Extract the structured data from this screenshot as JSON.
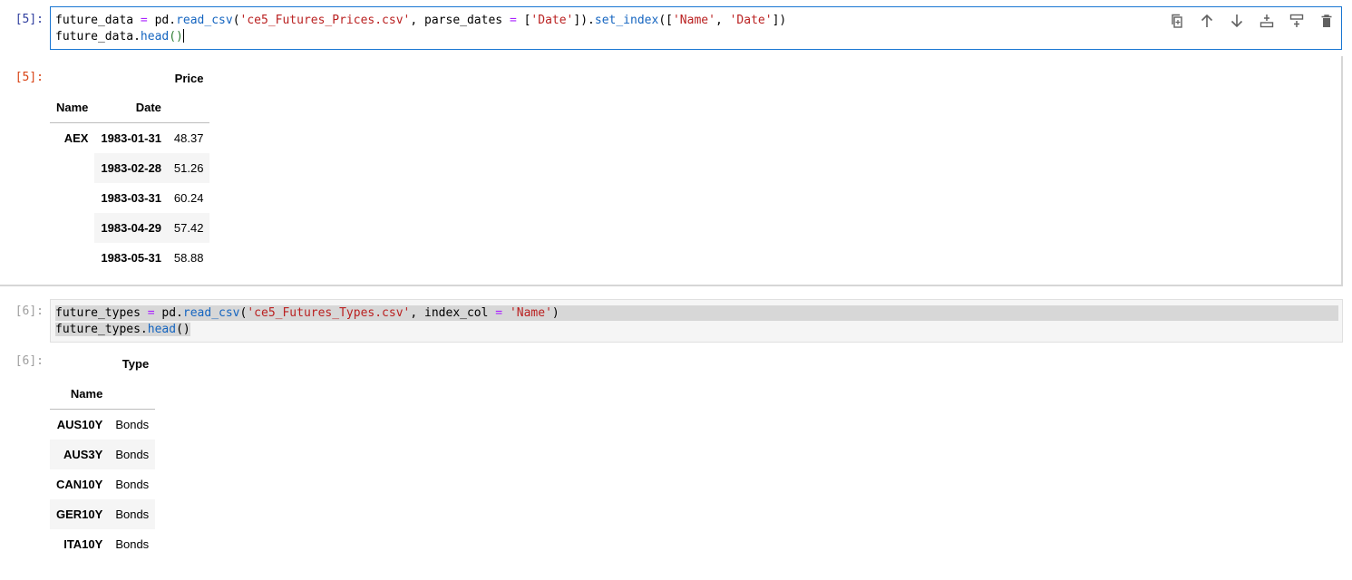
{
  "cells": [
    {
      "input_prompt": "[5]:",
      "output_prompt": "[5]:",
      "code_line1": {
        "t1": "future_data ",
        "op1": "=",
        "t2": " pd.",
        "fn1": "read_csv",
        "t3": "(",
        "s1": "'ce5_Futures_Prices.csv'",
        "t4": ", parse_dates ",
        "op2": "=",
        "t5": " [",
        "s2": "'Date'",
        "t6": "]).",
        "fn2": "set_index",
        "t7": "([",
        "s3": "'Name'",
        "t8": ", ",
        "s4": "'Date'",
        "t9": "])"
      },
      "code_line2": {
        "t1": "future_data.",
        "fn1": "head",
        "paren": "()"
      },
      "output_table": {
        "column": "Price",
        "index_names": [
          "Name",
          "Date"
        ],
        "first_level": "AEX",
        "rows": [
          {
            "date": "1983-01-31",
            "price": "48.37"
          },
          {
            "date": "1983-02-28",
            "price": "51.26"
          },
          {
            "date": "1983-03-31",
            "price": "60.24"
          },
          {
            "date": "1983-04-29",
            "price": "57.42"
          },
          {
            "date": "1983-05-31",
            "price": "58.88"
          }
        ]
      }
    },
    {
      "input_prompt": "[6]:",
      "output_prompt": "[6]:",
      "code_line1": {
        "t1": "future_types ",
        "op1": "=",
        "t2": " pd.",
        "fn1": "read_csv",
        "t3": "(",
        "s1": "'ce5_Futures_Types.csv'",
        "t4": ", index_col ",
        "op2": "=",
        "t5": " ",
        "s2": "'Name'",
        "t6": ")"
      },
      "code_line2": {
        "t1": "future_types.",
        "fn1": "head",
        "paren": "()"
      },
      "output_table": {
        "column": "Type",
        "index_name": "Name",
        "rows": [
          {
            "name": "AUS10Y",
            "type": "Bonds"
          },
          {
            "name": "AUS3Y",
            "type": "Bonds"
          },
          {
            "name": "CAN10Y",
            "type": "Bonds"
          },
          {
            "name": "GER10Y",
            "type": "Bonds"
          },
          {
            "name": "ITA10Y",
            "type": "Bonds"
          }
        ]
      }
    }
  ],
  "toolbar": {
    "icons": [
      "duplicate-icon",
      "move-up-icon",
      "move-down-icon",
      "insert-above-icon",
      "insert-below-icon",
      "delete-icon"
    ]
  },
  "colors": {
    "active_border": "#1976d2",
    "input_prompt": "#303f9f",
    "output_prompt": "#d84315",
    "string": "#ba2121",
    "function": "#1565c0",
    "operator": "#aa22ff"
  }
}
